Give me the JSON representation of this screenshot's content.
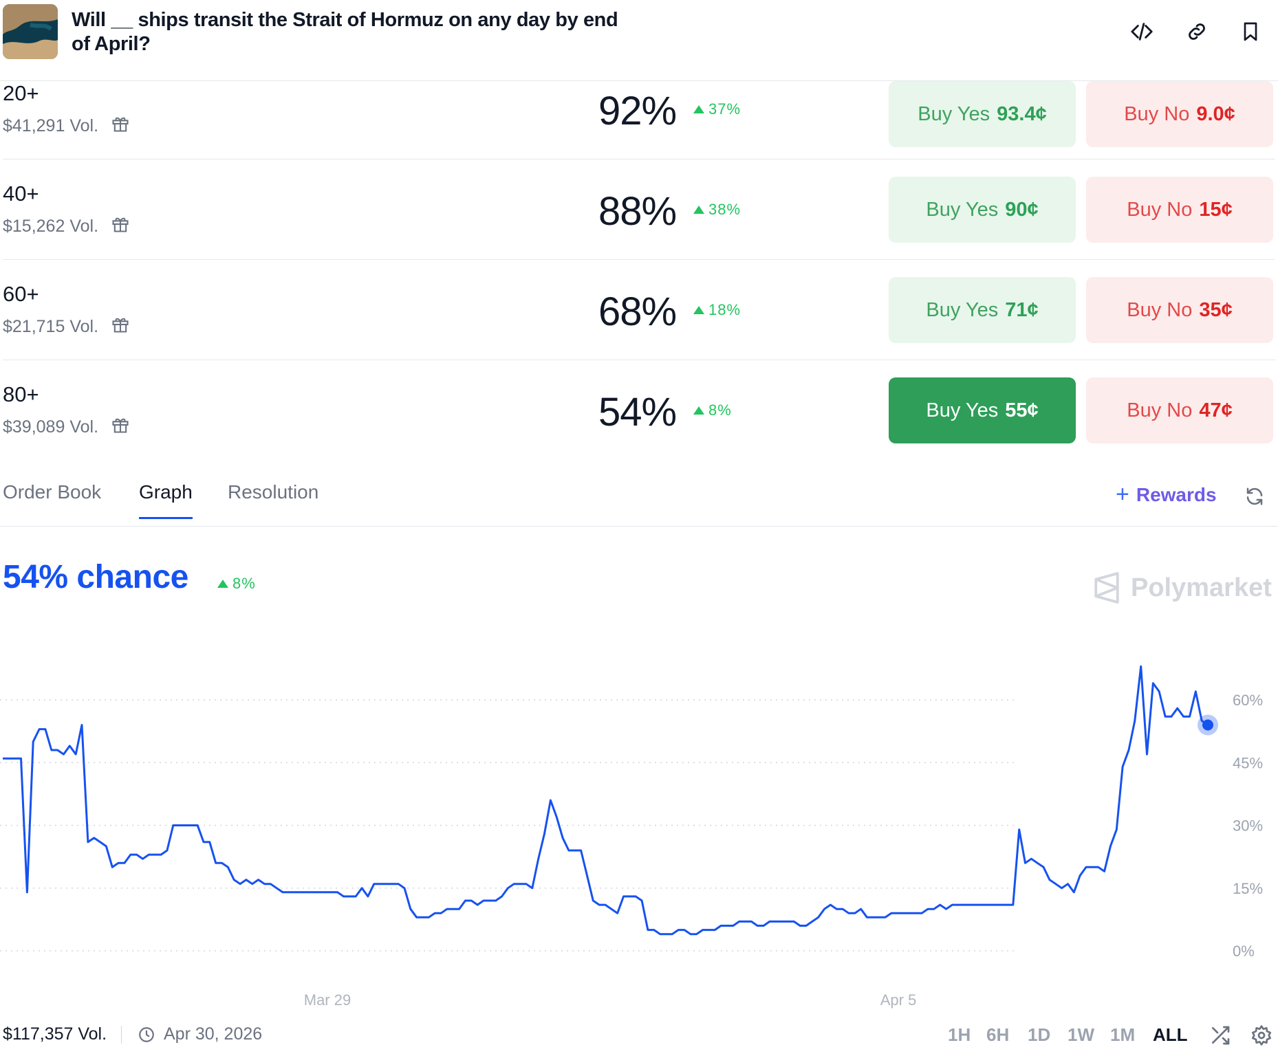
{
  "header": {
    "title": "Will __ ships transit the Strait of Hormuz on any day by end of April?",
    "icons": [
      "embed-code-icon",
      "link-icon",
      "bookmark-icon"
    ]
  },
  "outcomes": [
    {
      "label": "20+",
      "volume": "$41,291 Vol.",
      "percent": "92%",
      "change": "37%",
      "yes_label": "Buy Yes",
      "yes_price": "93.4¢",
      "no_label": "Buy No",
      "no_price": "9.0¢"
    },
    {
      "label": "40+",
      "volume": "$15,262 Vol.",
      "percent": "88%",
      "change": "38%",
      "yes_label": "Buy Yes",
      "yes_price": "90¢",
      "no_label": "Buy No",
      "no_price": "15¢"
    },
    {
      "label": "60+",
      "volume": "$21,715 Vol.",
      "percent": "68%",
      "change": "18%",
      "yes_label": "Buy Yes",
      "yes_price": "71¢",
      "no_label": "Buy No",
      "no_price": "35¢"
    },
    {
      "label": "80+",
      "volume": "$39,089 Vol.",
      "percent": "54%",
      "change": "8%",
      "yes_label": "Buy Yes",
      "yes_price": "55¢",
      "no_label": "Buy No",
      "no_price": "47¢",
      "selected": true
    }
  ],
  "tabs": [
    {
      "label": "Order Book",
      "active": false
    },
    {
      "label": "Graph",
      "active": true
    },
    {
      "label": "Resolution",
      "active": false
    }
  ],
  "rewards": {
    "plus": "+",
    "label": "Rewards"
  },
  "chance": {
    "text": "54% chance",
    "change": "8%"
  },
  "brand": "Polymarket",
  "chart_data": {
    "type": "line",
    "x_ticks": [
      "Mar 29",
      "Apr 5"
    ],
    "y_ticks": [
      "0%",
      "15%",
      "30%",
      "45%",
      "60%"
    ],
    "ylim": [
      0,
      60
    ],
    "grid": true,
    "series": [
      {
        "color": "#1652f0",
        "values": [
          46,
          46,
          46,
          46,
          14,
          50,
          53,
          53,
          48,
          48,
          47,
          49,
          47,
          54,
          26,
          27,
          26,
          25,
          20,
          21,
          21,
          23,
          23,
          22,
          23,
          23,
          23,
          24,
          30,
          30,
          30,
          30,
          30,
          26,
          26,
          21,
          21,
          20,
          17,
          16,
          17,
          16,
          17,
          16,
          16,
          15,
          14,
          14,
          14,
          14,
          14,
          14,
          14,
          14,
          14,
          14,
          13,
          13,
          13,
          15,
          13,
          16,
          16,
          16,
          16,
          16,
          15,
          10,
          8,
          8,
          8,
          9,
          9,
          10,
          10,
          10,
          12,
          12,
          11,
          12,
          12,
          12,
          13,
          15,
          16,
          16,
          16,
          15,
          22,
          28,
          36,
          32,
          27,
          24,
          24,
          24,
          18,
          12,
          11,
          11,
          10,
          9,
          13,
          13,
          13,
          12,
          5,
          5,
          4,
          4,
          4,
          5,
          5,
          4,
          4,
          5,
          5,
          5,
          6,
          6,
          6,
          7,
          7,
          7,
          6,
          6,
          7,
          7,
          7,
          7,
          7,
          6,
          6,
          7,
          8,
          10,
          11,
          10,
          10,
          9,
          9,
          10,
          8,
          8,
          8,
          8,
          9,
          9,
          9,
          9,
          9,
          9,
          10,
          10,
          11,
          10,
          11,
          11,
          11,
          11,
          11,
          11,
          11,
          11,
          11,
          11,
          11,
          29,
          21,
          22,
          21,
          20,
          17,
          16,
          15,
          16,
          14,
          18,
          20,
          20,
          20,
          19,
          25,
          29,
          44,
          48,
          55,
          68,
          47,
          64,
          62,
          56,
          56,
          58,
          56,
          56,
          62,
          55,
          54
        ]
      }
    ],
    "end_value": 54
  },
  "footer": {
    "volume": "$117,357 Vol.",
    "end_date": "Apr 30, 2026",
    "ranges": [
      {
        "label": "1H",
        "active": false
      },
      {
        "label": "6H",
        "active": false
      },
      {
        "label": "1D",
        "active": false
      },
      {
        "label": "1W",
        "active": false
      },
      {
        "label": "1M",
        "active": false
      },
      {
        "label": "ALL",
        "active": true
      }
    ]
  },
  "colors": {
    "accent": "#1652f0",
    "yes": "#2e9e58",
    "no": "#e02424",
    "up": "#22c55e"
  }
}
